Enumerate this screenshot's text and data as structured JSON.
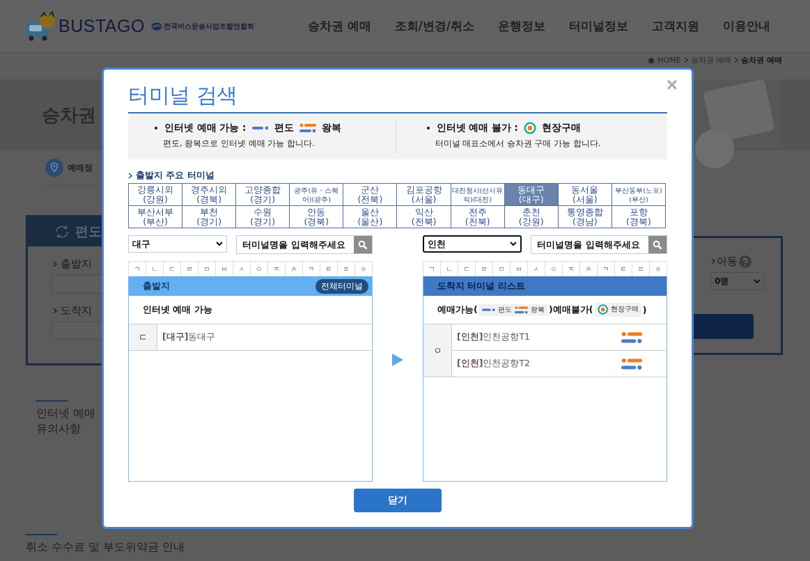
{
  "page": {
    "logo": {
      "name": "BUSTAGO",
      "org": "전국버스운송사업조합연합회"
    },
    "nav": [
      "승차권 예매",
      "조회/변경/취소",
      "운행정보",
      "터미널정보",
      "고객지원",
      "이용안내"
    ],
    "breadcrumb": [
      {
        "label": "HOME",
        "kind": "home",
        "current": false
      },
      {
        "label": "승차권 예매",
        "current": false
      },
      {
        "label": "승차권 예매",
        "current": true
      }
    ],
    "title": "승차권",
    "step": "예매정",
    "trip_tab": "편도",
    "fields": [
      "출발지",
      "도착지"
    ],
    "child": {
      "label": "아동",
      "value": "0명"
    },
    "notice": [
      "인터넷 예매",
      "유의사항"
    ],
    "cancel_title": "취소 수수료 및 부도위약금 안내"
  },
  "dialog": {
    "title": "터미널 검색",
    "close": "×",
    "legend": {
      "available": {
        "label": "인터넷 예매 가능 :",
        "one_way": "편도",
        "round": "왕복",
        "note": "편도, 왕복으로 인터넷 예매 가능 합니다."
      },
      "unavailable": {
        "label": "인터넷 예매 불가 :",
        "onsite": "현장구매",
        "note": "터미널 매표소에서 승차권 구매 가능 합니다."
      }
    },
    "major_title": "출발지 주요 터미널",
    "major_terminals": [
      {
        "name": "강릉시외",
        "region": "(강원)",
        "selected": false
      },
      {
        "name": "경주시외",
        "region": "(경북)",
        "selected": false
      },
      {
        "name": "고양종합",
        "region": "(경기)",
        "selected": false
      },
      {
        "name": "광주(유・스퀘어)",
        "region": "(광주)",
        "selected": false,
        "kind": "small"
      },
      {
        "name": "군산",
        "region": "(전북)",
        "selected": false
      },
      {
        "name": "김포공항",
        "region": "(서울)",
        "selected": false
      },
      {
        "name": "대전청사(선사유적)",
        "region": "(대전)",
        "selected": false,
        "kind": "small"
      },
      {
        "name": "동대구",
        "region": "(대구)",
        "selected": true
      },
      {
        "name": "동서울",
        "region": "(서울)",
        "selected": false
      },
      {
        "name": "부산동부(노포)",
        "region": "(부산)",
        "selected": false,
        "kind": "small"
      },
      {
        "name": "부산서부",
        "region": "(부산)",
        "selected": false
      },
      {
        "name": "부천",
        "region": "(경기)",
        "selected": false
      },
      {
        "name": "수원",
        "region": "(경기)",
        "selected": false
      },
      {
        "name": "안동",
        "region": "(경북)",
        "selected": false
      },
      {
        "name": "울산",
        "region": "(울산)",
        "selected": false
      },
      {
        "name": "익산",
        "region": "(전북)",
        "selected": false
      },
      {
        "name": "전주",
        "region": "(전북)",
        "selected": false
      },
      {
        "name": "춘천",
        "region": "(강원)",
        "selected": false
      },
      {
        "name": "통영종합",
        "region": "(경남)",
        "selected": false
      },
      {
        "name": "포항",
        "region": "(경북)",
        "selected": false
      }
    ],
    "departure": {
      "region": "대구",
      "focused": false,
      "active": false,
      "search_placeholder": "터미널명을 입력해주세요",
      "consonants": [
        "ㄱ",
        "ㄴ",
        "ㄷ",
        "ㄹ",
        "ㅁ",
        "ㅂ",
        "ㅅ",
        "ㅇ",
        "ㅈ",
        "ㅊ",
        "ㅋ",
        "ㅌ",
        "ㅍ",
        "ㅎ"
      ],
      "header": "출발지",
      "all_button": "전체터미널",
      "group_title": "인터넷 예매 가능",
      "groups": [
        {
          "index": "ㄷ",
          "terminals": [
            {
              "label": "**[대구]**동대구"
            }
          ]
        }
      ]
    },
    "arrival": {
      "region": "인천",
      "focused": true,
      "active": true,
      "search_placeholder": "터미널명을 입력해주세요",
      "consonants": [
        "ㄱ",
        "ㄴ",
        "ㄷ",
        "ㄹ",
        "ㅁ",
        "ㅂ",
        "ㅅ",
        "ㅇ",
        "ㅈ",
        "ㅊ",
        "ㅋ",
        "ㅌ",
        "ㅍ",
        "ㅎ"
      ],
      "header": "도착지 터미널 리스트",
      "legend": {
        "open": "예매가능(",
        "one_way": "편도",
        "round": "왕복",
        "middle": ")예매불가(",
        "onsite": "현장구매",
        "close": ")"
      },
      "groups": [
        {
          "index": "ㅇ",
          "terminals": [
            {
              "label": "**[인천]**인천공항T1",
              "kind": "round"
            },
            {
              "label": "**[인천]**인천공항T2",
              "kind": "round"
            }
          ]
        }
      ]
    },
    "close_button": "닫기"
  }
}
